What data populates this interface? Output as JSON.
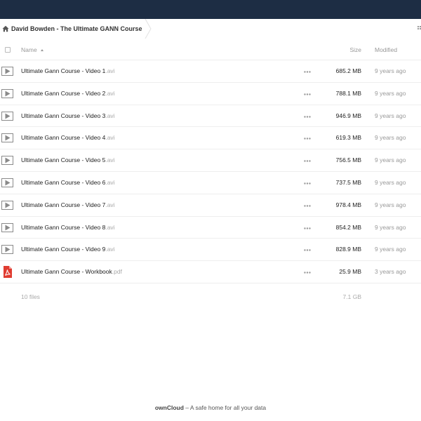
{
  "breadcrumb": {
    "folder": "David Bowden - The Ultimate GANN Course"
  },
  "header": {
    "name_label": "Name",
    "size_label": "Size",
    "modified_label": "Modified"
  },
  "files": [
    {
      "base": "Ultimate Gann Course - Video 1",
      "ext": ".avi",
      "size": "685.2 MB",
      "modified": "9 years ago",
      "icon": "video-file-icon"
    },
    {
      "base": "Ultimate Gann Course - Video 2",
      "ext": ".avi",
      "size": "788.1 MB",
      "modified": "9 years ago",
      "icon": "video-file-icon"
    },
    {
      "base": "Ultimate Gann Course - Video 3",
      "ext": ".avi",
      "size": "946.9 MB",
      "modified": "9 years ago",
      "icon": "video-file-icon"
    },
    {
      "base": "Ultimate Gann Course - Video 4",
      "ext": ".avi",
      "size": "619.3 MB",
      "modified": "9 years ago",
      "icon": "video-file-icon"
    },
    {
      "base": "Ultimate Gann Course - Video 5",
      "ext": ".avi",
      "size": "756.5 MB",
      "modified": "9 years ago",
      "icon": "video-file-icon"
    },
    {
      "base": "Ultimate Gann Course - Video 6",
      "ext": ".avi",
      "size": "737.5 MB",
      "modified": "9 years ago",
      "icon": "video-file-icon"
    },
    {
      "base": "Ultimate Gann Course - Video 7",
      "ext": ".avi",
      "size": "978.4 MB",
      "modified": "9 years ago",
      "icon": "video-file-icon"
    },
    {
      "base": "Ultimate Gann Course - Video 8",
      "ext": ".avi",
      "size": "854.2 MB",
      "modified": "9 years ago",
      "icon": "video-file-icon"
    },
    {
      "base": "Ultimate Gann Course - Video 9",
      "ext": ".avi",
      "size": "828.9 MB",
      "modified": "9 years ago",
      "icon": "video-file-icon"
    },
    {
      "base": "Ultimate Gann Course - Workbook",
      "ext": ".pdf",
      "size": "25.9 MB",
      "modified": "3 years ago",
      "icon": "pdf-file-icon"
    }
  ],
  "summary": {
    "count": "10 files",
    "total": "7.1 GB"
  },
  "footer": {
    "brand": "ownCloud",
    "tagline": " – A safe home for all your data"
  },
  "colors": {
    "topbar": "#1d2d44",
    "video_icon": "#8a8a8a",
    "pdf_icon": "#e03c31"
  }
}
